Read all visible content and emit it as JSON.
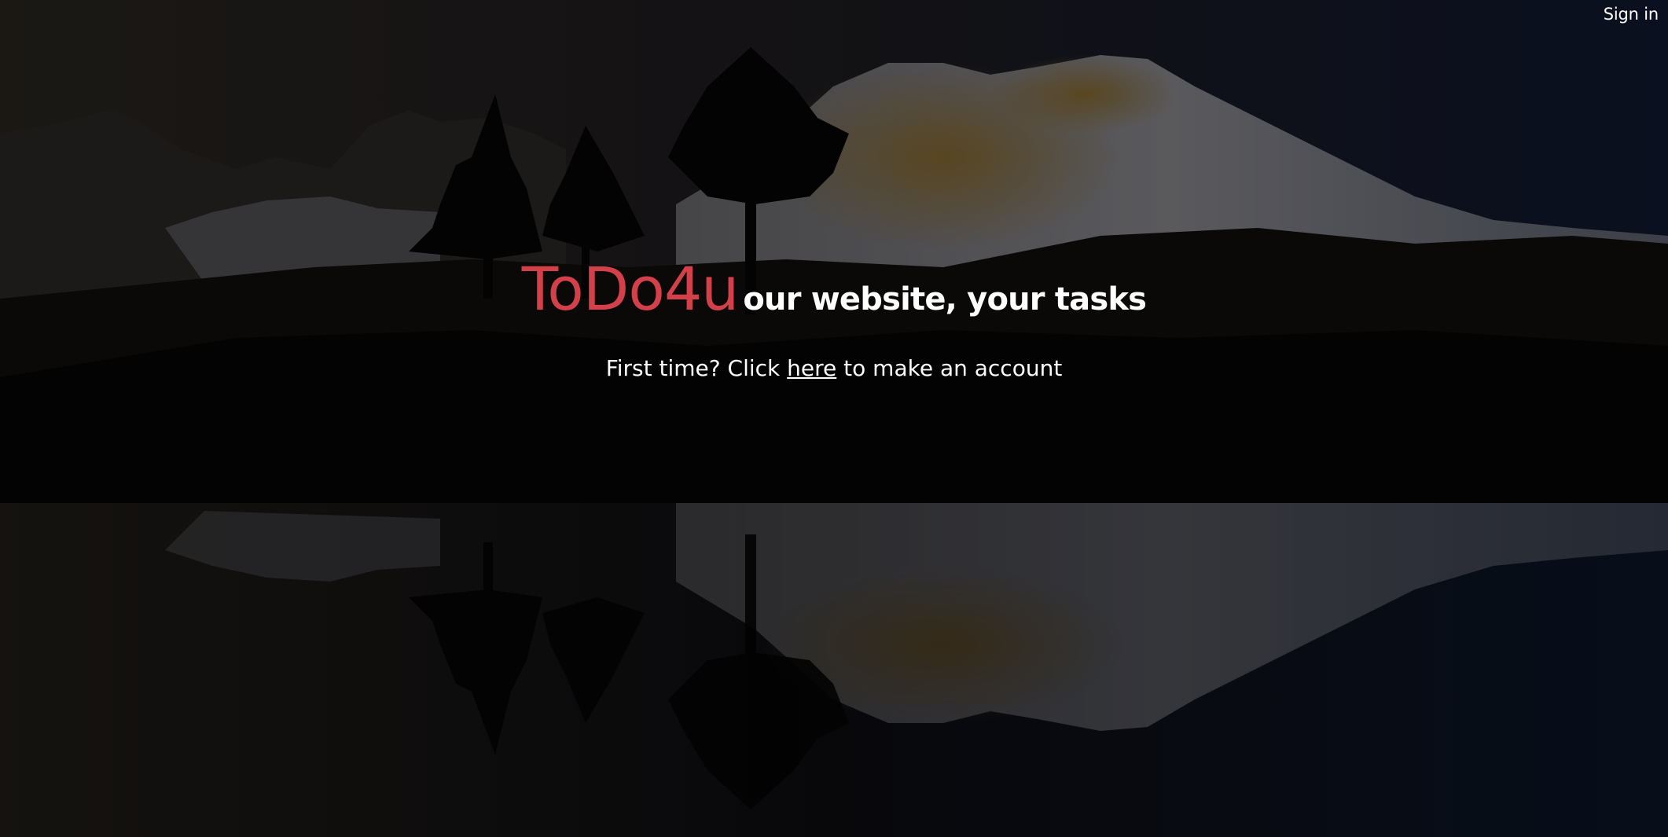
{
  "header": {
    "signin_label": "Sign in"
  },
  "hero": {
    "brand": "ToDo4u",
    "tagline": "our website, your tasks",
    "signup_prefix": "First time? Click ",
    "signup_link": "here",
    "signup_suffix": " to make an account"
  },
  "colors": {
    "brand": "#d2404a",
    "text": "#ffffff",
    "overlay": "#000000"
  },
  "background": {
    "description_icon": "mountain-lake-reflection-photo"
  }
}
